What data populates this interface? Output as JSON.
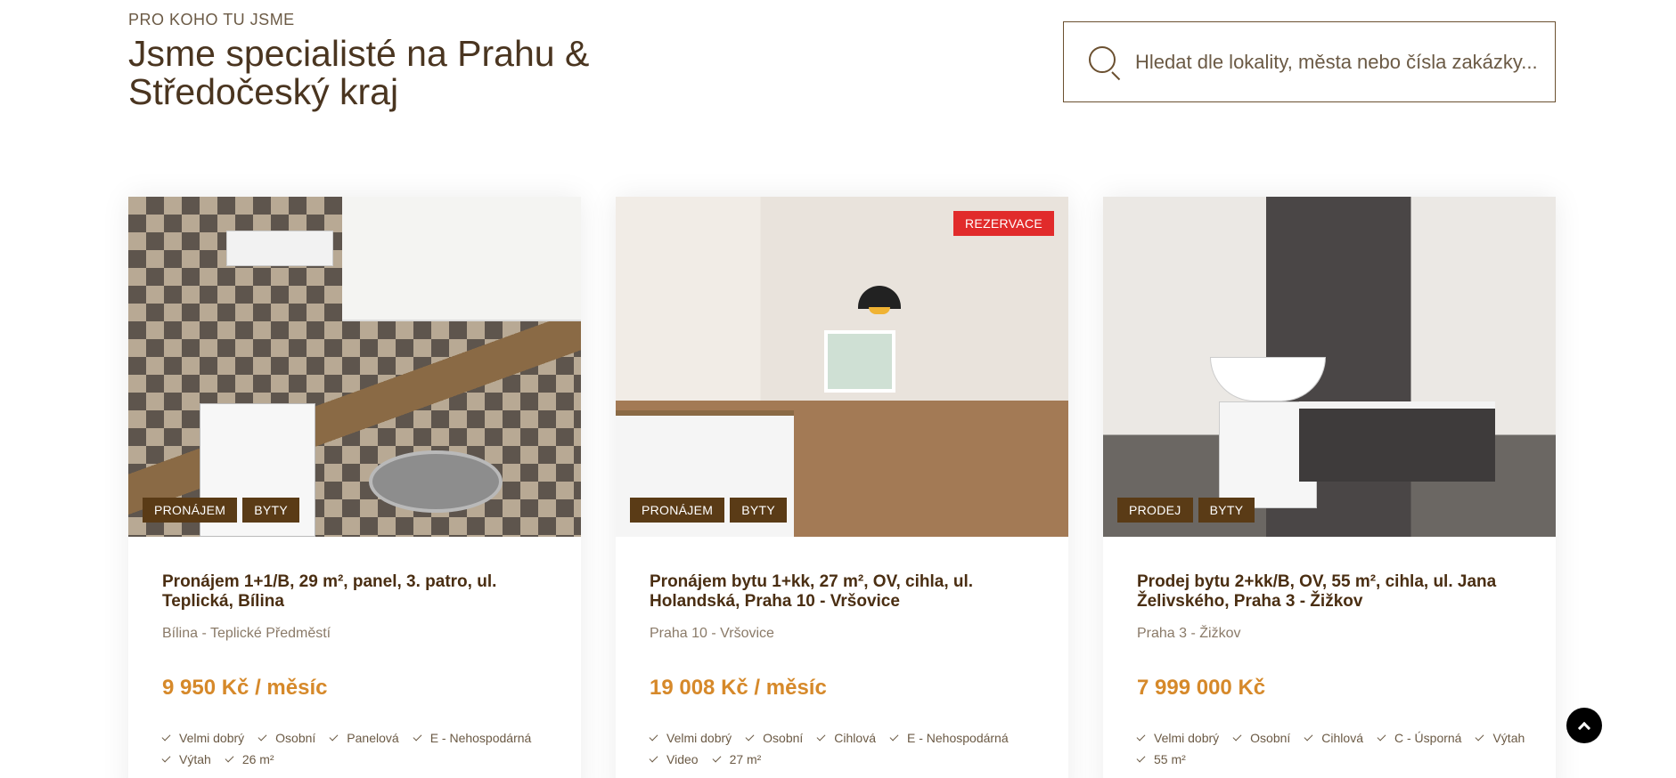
{
  "header": {
    "eyebrow": "PRO KOHO TU JSME",
    "headline": "Jsme specialisté na Prahu & Středočeský kraj"
  },
  "search": {
    "placeholder": "Hledat dle lokality, města nebo čísla zakázky..."
  },
  "colors": {
    "accent_brown": "#5a3b16",
    "price_orange": "#d6892a",
    "reserve_red": "#e12b2b"
  },
  "listings": [
    {
      "image_icon": "kitchen-photo",
      "tags": [
        "PRONÁJEM",
        "BYTY"
      ],
      "reserve_badge": "",
      "title": "Pronájem 1+1/B, 29 m², panel, 3. patro, ul. Teplická, Bílina",
      "location": "Bílina - Teplické Předměstí",
      "price": "9 950 Kč / měsíc",
      "features": [
        "Velmi dobrý",
        "Osobní",
        "Panelová",
        "E - Nehospodárná",
        "Výtah",
        "26 m²"
      ]
    },
    {
      "image_icon": "living-room-photo",
      "tags": [
        "PRONÁJEM",
        "BYTY"
      ],
      "reserve_badge": "REZERVACE",
      "title": "Pronájem bytu 1+kk, 27 m², OV, cihla, ul. Holandská, Praha 10 - Vršovice",
      "location": "Praha 10 - Vršovice",
      "price": "19 008 Kč / měsíc",
      "features": [
        "Velmi dobrý",
        "Osobní",
        "Cihlová",
        "E - Nehospodárná",
        "Video",
        "27 m²"
      ]
    },
    {
      "image_icon": "bathroom-photo",
      "tags": [
        "PRODEJ",
        "BYTY"
      ],
      "reserve_badge": "",
      "title": "Prodej bytu 2+kk/B, OV, 55 m², cihla, ul. Jana Želivského, Praha 3 - Žižkov",
      "location": "Praha 3 - Žižkov",
      "price": "7 999 000 Kč",
      "features": [
        "Velmi dobrý",
        "Osobní",
        "Cihlová",
        "C - Úsporná",
        "Výtah",
        "55 m²"
      ]
    }
  ]
}
